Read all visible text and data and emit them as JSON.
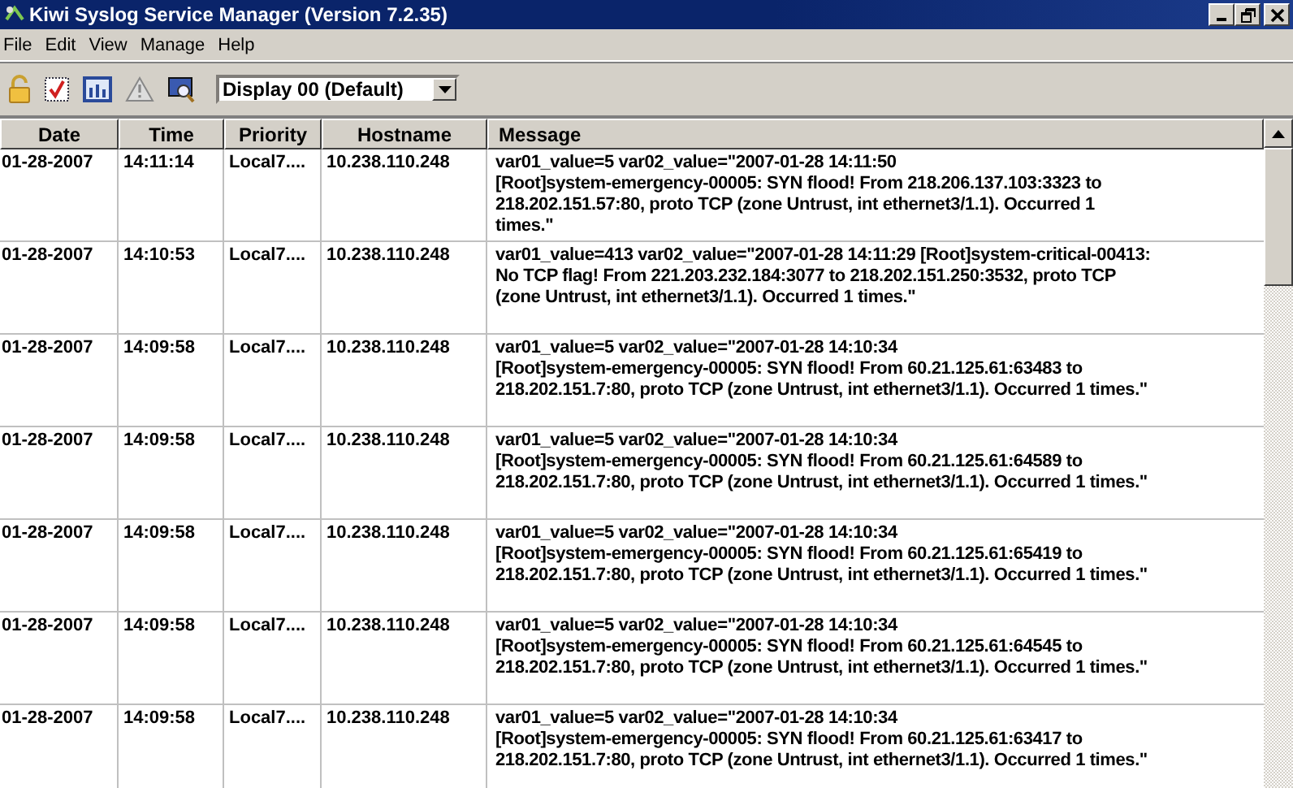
{
  "window": {
    "title": "Kiwi Syslog Service Manager (Version 7.2.35)"
  },
  "menu": [
    "File",
    "Edit",
    "View",
    "Manage",
    "Help"
  ],
  "toolbar": {
    "display": "Display 00 (Default)"
  },
  "table": {
    "columns": [
      "Date",
      "Time",
      "Priority",
      "Hostname",
      "Message"
    ],
    "rows": [
      {
        "date": "01-28-2007",
        "time": "14:11:14",
        "priority": "Local7....",
        "hostname": "10.238.110.248",
        "message": "var01_value=5 var02_value=\"2007-01-28 14:11:50\n[Root]system-emergency-00005: SYN flood! From 218.206.137.103:3323 to\n218.202.151.57:80, proto TCP (zone Untrust, int ethernet3/1.1). Occurred 1\ntimes.\""
      },
      {
        "date": "01-28-2007",
        "time": "14:10:53",
        "priority": "Local7....",
        "hostname": "10.238.110.248",
        "message": "var01_value=413 var02_value=\"2007-01-28 14:11:29 [Root]system-critical-00413:\nNo TCP flag! From 221.203.232.184:3077 to 218.202.151.250:3532, proto TCP\n(zone Untrust, int ethernet3/1.1). Occurred 1 times.\""
      },
      {
        "date": "01-28-2007",
        "time": "14:09:58",
        "priority": "Local7....",
        "hostname": "10.238.110.248",
        "message": "var01_value=5 var02_value=\"2007-01-28 14:10:34\n[Root]system-emergency-00005: SYN flood! From 60.21.125.61:63483 to\n218.202.151.7:80, proto TCP (zone Untrust, int ethernet3/1.1). Occurred 1 times.\""
      },
      {
        "date": "01-28-2007",
        "time": "14:09:58",
        "priority": "Local7....",
        "hostname": "10.238.110.248",
        "message": "var01_value=5 var02_value=\"2007-01-28 14:10:34\n[Root]system-emergency-00005: SYN flood! From 60.21.125.61:64589 to\n218.202.151.7:80, proto TCP (zone Untrust, int ethernet3/1.1). Occurred 1 times.\""
      },
      {
        "date": "01-28-2007",
        "time": "14:09:58",
        "priority": "Local7....",
        "hostname": "10.238.110.248",
        "message": "var01_value=5 var02_value=\"2007-01-28 14:10:34\n[Root]system-emergency-00005: SYN flood! From 60.21.125.61:65419 to\n218.202.151.7:80, proto TCP (zone Untrust, int ethernet3/1.1). Occurred 1 times.\""
      },
      {
        "date": "01-28-2007",
        "time": "14:09:58",
        "priority": "Local7....",
        "hostname": "10.238.110.248",
        "message": "var01_value=5 var02_value=\"2007-01-28 14:10:34\n[Root]system-emergency-00005: SYN flood! From 60.21.125.61:64545 to\n218.202.151.7:80, proto TCP (zone Untrust, int ethernet3/1.1). Occurred 1 times.\""
      },
      {
        "date": "01-28-2007",
        "time": "14:09:58",
        "priority": "Local7....",
        "hostname": "10.238.110.248",
        "message": "var01_value=5 var02_value=\"2007-01-28 14:10:34\n[Root]system-emergency-00005: SYN flood! From 60.21.125.61:63417 to\n218.202.151.7:80, proto TCP (zone Untrust, int ethernet3/1.1). Occurred 1 times.\""
      }
    ]
  }
}
